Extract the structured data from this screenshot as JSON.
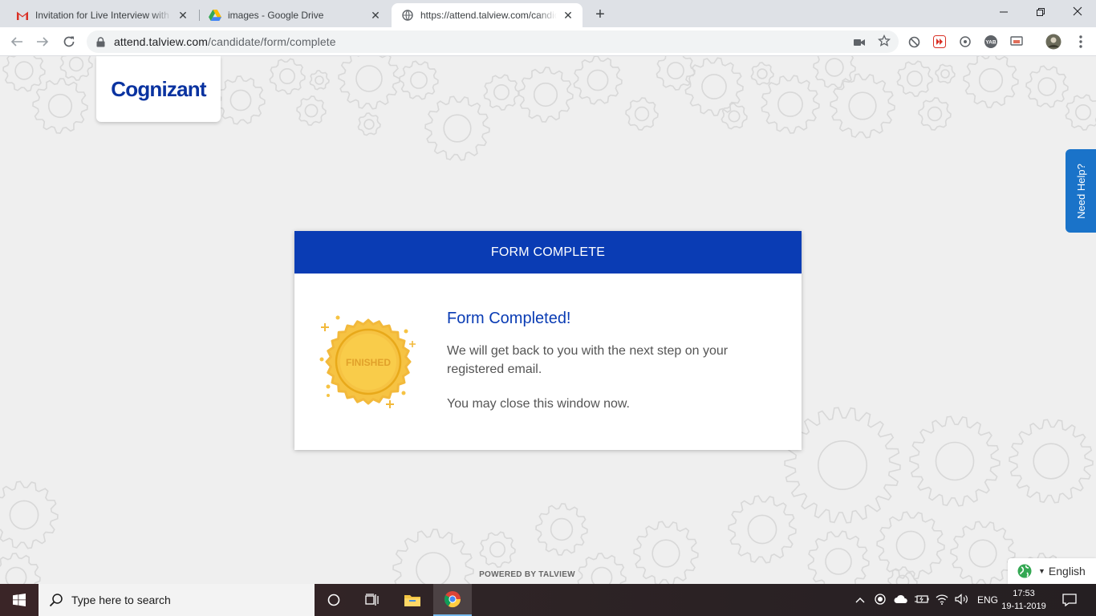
{
  "browser": {
    "tabs": [
      {
        "title": "Invitation for Live Interview with Cognizant",
        "favicon": "gmail-icon",
        "active": false
      },
      {
        "title": "images - Google Drive",
        "favicon": "google-drive-icon",
        "active": false
      },
      {
        "title": "https://attend.talview.com/candidate/form/complete",
        "favicon": "globe-icon",
        "active": true
      }
    ],
    "url_host": "attend.talview.com",
    "url_path": "/candidate/form/complete"
  },
  "page": {
    "logo_text": "Cognizant",
    "help_label": "Need Help?",
    "card": {
      "header": "FORM COMPLETE",
      "badge_text": "FINISHED",
      "title": "Form Completed!",
      "message": "We will get back to you with the next step on your registered email.",
      "message2": "You may close this window now."
    },
    "powered_by": "POWERED BY TALVIEW",
    "language": "English"
  },
  "taskbar": {
    "search_placeholder": "Type here to search",
    "lang_indicator": "ENG",
    "time": "17:53",
    "date": "19-11-2019"
  },
  "colors": {
    "brand_blue": "#0a3cb4",
    "help_blue": "#1a73c9",
    "badge_gold": "#f6c343"
  }
}
